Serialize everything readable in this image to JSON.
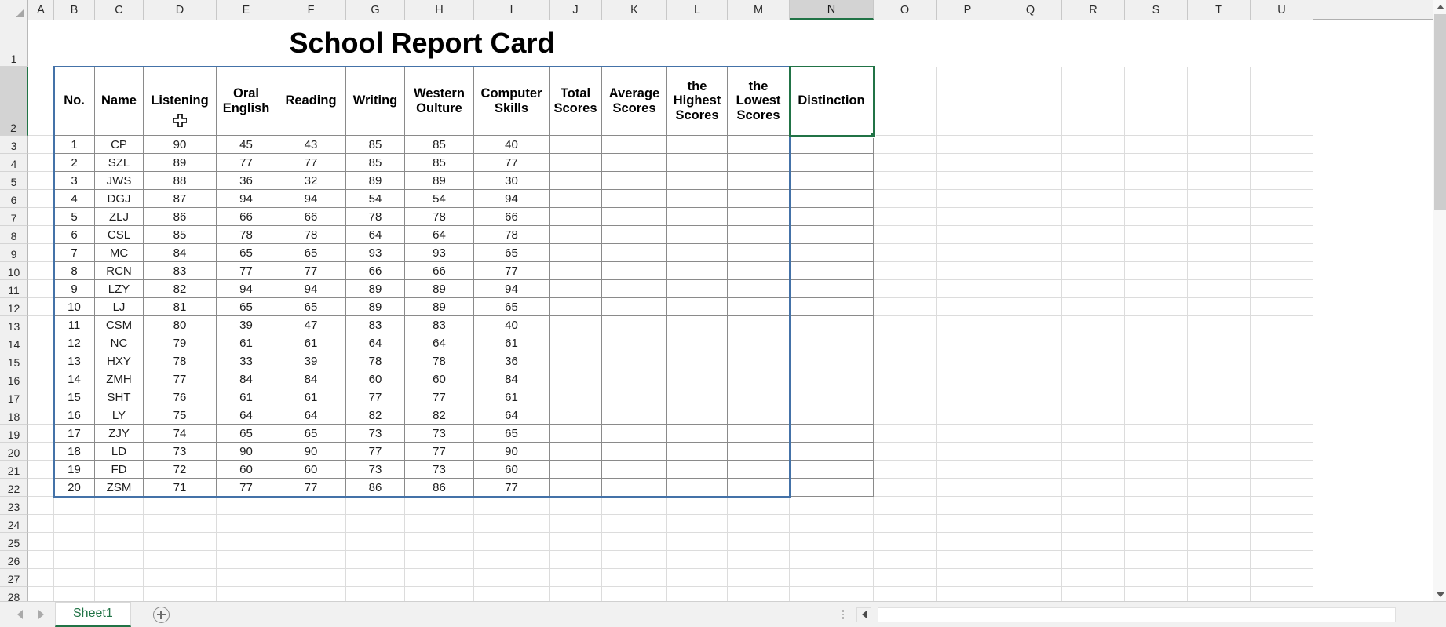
{
  "app": {
    "title": "School Report Card"
  },
  "grid": {
    "column_headers": [
      "A",
      "B",
      "C",
      "D",
      "E",
      "F",
      "G",
      "H",
      "I",
      "J",
      "K",
      "L",
      "M",
      "N",
      "O",
      "P",
      "Q",
      "R",
      "S",
      "T",
      "U"
    ],
    "active_column": "N",
    "active_row": "2",
    "active_cell": "N2",
    "row_headers": [
      "1",
      "2",
      "3",
      "4",
      "5",
      "6",
      "7",
      "8",
      "9",
      "10",
      "11",
      "12",
      "13",
      "14",
      "15",
      "16",
      "17",
      "18",
      "19",
      "20",
      "21",
      "22",
      "23",
      "24",
      "25",
      "26",
      "27",
      "28"
    ],
    "selection_color": "#217346",
    "range_border_color": "#4472a8",
    "cursor_icon": "crosshair-cell-cursor"
  },
  "report": {
    "title": "School Report Card",
    "headers": [
      "No.",
      "Name",
      "Listening",
      "Oral English",
      "Reading",
      "Writing",
      "Western Oulture",
      "Computer Skills",
      "Total Scores",
      "Average Scores",
      "the Highest Scores",
      "the Lowest Scores",
      "Distinction"
    ],
    "rows": [
      {
        "no": "1",
        "name": "CP",
        "listening": "90",
        "oral": "45",
        "reading": "43",
        "writing": "85",
        "western": "85",
        "computer": "40",
        "total": "",
        "average": "",
        "highest": "",
        "lowest": "",
        "distinction": ""
      },
      {
        "no": "2",
        "name": "SZL",
        "listening": "89",
        "oral": "77",
        "reading": "77",
        "writing": "85",
        "western": "85",
        "computer": "77",
        "total": "",
        "average": "",
        "highest": "",
        "lowest": "",
        "distinction": ""
      },
      {
        "no": "3",
        "name": "JWS",
        "listening": "88",
        "oral": "36",
        "reading": "32",
        "writing": "89",
        "western": "89",
        "computer": "30",
        "total": "",
        "average": "",
        "highest": "",
        "lowest": "",
        "distinction": ""
      },
      {
        "no": "4",
        "name": "DGJ",
        "listening": "87",
        "oral": "94",
        "reading": "94",
        "writing": "54",
        "western": "54",
        "computer": "94",
        "total": "",
        "average": "",
        "highest": "",
        "lowest": "",
        "distinction": ""
      },
      {
        "no": "5",
        "name": "ZLJ",
        "listening": "86",
        "oral": "66",
        "reading": "66",
        "writing": "78",
        "western": "78",
        "computer": "66",
        "total": "",
        "average": "",
        "highest": "",
        "lowest": "",
        "distinction": ""
      },
      {
        "no": "6",
        "name": "CSL",
        "listening": "85",
        "oral": "78",
        "reading": "78",
        "writing": "64",
        "western": "64",
        "computer": "78",
        "total": "",
        "average": "",
        "highest": "",
        "lowest": "",
        "distinction": ""
      },
      {
        "no": "7",
        "name": "MC",
        "listening": "84",
        "oral": "65",
        "reading": "65",
        "writing": "93",
        "western": "93",
        "computer": "65",
        "total": "",
        "average": "",
        "highest": "",
        "lowest": "",
        "distinction": ""
      },
      {
        "no": "8",
        "name": "RCN",
        "listening": "83",
        "oral": "77",
        "reading": "77",
        "writing": "66",
        "western": "66",
        "computer": "77",
        "total": "",
        "average": "",
        "highest": "",
        "lowest": "",
        "distinction": ""
      },
      {
        "no": "9",
        "name": "LZY",
        "listening": "82",
        "oral": "94",
        "reading": "94",
        "writing": "89",
        "western": "89",
        "computer": "94",
        "total": "",
        "average": "",
        "highest": "",
        "lowest": "",
        "distinction": ""
      },
      {
        "no": "10",
        "name": "LJ",
        "listening": "81",
        "oral": "65",
        "reading": "65",
        "writing": "89",
        "western": "89",
        "computer": "65",
        "total": "",
        "average": "",
        "highest": "",
        "lowest": "",
        "distinction": ""
      },
      {
        "no": "11",
        "name": "CSM",
        "listening": "80",
        "oral": "39",
        "reading": "47",
        "writing": "83",
        "western": "83",
        "computer": "40",
        "total": "",
        "average": "",
        "highest": "",
        "lowest": "",
        "distinction": ""
      },
      {
        "no": "12",
        "name": "NC",
        "listening": "79",
        "oral": "61",
        "reading": "61",
        "writing": "64",
        "western": "64",
        "computer": "61",
        "total": "",
        "average": "",
        "highest": "",
        "lowest": "",
        "distinction": ""
      },
      {
        "no": "13",
        "name": "HXY",
        "listening": "78",
        "oral": "33",
        "reading": "39",
        "writing": "78",
        "western": "78",
        "computer": "36",
        "total": "",
        "average": "",
        "highest": "",
        "lowest": "",
        "distinction": ""
      },
      {
        "no": "14",
        "name": "ZMH",
        "listening": "77",
        "oral": "84",
        "reading": "84",
        "writing": "60",
        "western": "60",
        "computer": "84",
        "total": "",
        "average": "",
        "highest": "",
        "lowest": "",
        "distinction": ""
      },
      {
        "no": "15",
        "name": "SHT",
        "listening": "76",
        "oral": "61",
        "reading": "61",
        "writing": "77",
        "western": "77",
        "computer": "61",
        "total": "",
        "average": "",
        "highest": "",
        "lowest": "",
        "distinction": ""
      },
      {
        "no": "16",
        "name": "LY",
        "listening": "75",
        "oral": "64",
        "reading": "64",
        "writing": "82",
        "western": "82",
        "computer": "64",
        "total": "",
        "average": "",
        "highest": "",
        "lowest": "",
        "distinction": ""
      },
      {
        "no": "17",
        "name": "ZJY",
        "listening": "74",
        "oral": "65",
        "reading": "65",
        "writing": "73",
        "western": "73",
        "computer": "65",
        "total": "",
        "average": "",
        "highest": "",
        "lowest": "",
        "distinction": ""
      },
      {
        "no": "18",
        "name": "LD",
        "listening": "73",
        "oral": "90",
        "reading": "90",
        "writing": "77",
        "western": "77",
        "computer": "90",
        "total": "",
        "average": "",
        "highest": "",
        "lowest": "",
        "distinction": ""
      },
      {
        "no": "19",
        "name": "FD",
        "listening": "72",
        "oral": "60",
        "reading": "60",
        "writing": "73",
        "western": "73",
        "computer": "60",
        "total": "",
        "average": "",
        "highest": "",
        "lowest": "",
        "distinction": ""
      },
      {
        "no": "20",
        "name": "ZSM",
        "listening": "71",
        "oral": "77",
        "reading": "77",
        "writing": "86",
        "western": "86",
        "computer": "77",
        "total": "",
        "average": "",
        "highest": "",
        "lowest": "",
        "distinction": ""
      }
    ]
  },
  "status_bar": {
    "sheet_tab": "Sheet1",
    "prev_sheet_icon": "triangle-left-icon",
    "next_sheet_icon": "triangle-right-icon",
    "add_sheet_icon": "plus-circle-icon",
    "scroll_left_icon": "triangle-left-icon",
    "grip_icon": "vertical-dots-icon"
  }
}
